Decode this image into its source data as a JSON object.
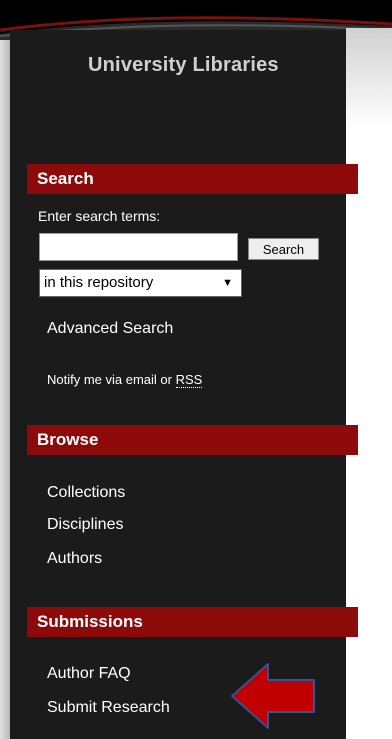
{
  "sidebar": {
    "title": "University Libraries"
  },
  "search": {
    "header": "Search",
    "prompt": "Enter search terms:",
    "input_value": "",
    "button_label": "Search",
    "scope_selected": "in this repository",
    "advanced_link": "Advanced Search",
    "notify_text": "Notify me via email or",
    "rss_label": "RSS"
  },
  "browse": {
    "header": "Browse",
    "items": [
      "Collections",
      "Disciplines",
      "Authors"
    ]
  },
  "submissions": {
    "header": "Submissions",
    "items": [
      "Author FAQ",
      "Submit Research"
    ]
  },
  "colors": {
    "sidebar_bg": "#1b1b1b",
    "header_red": "#8c0a0a",
    "arrow_red": "#c00000",
    "arrow_outline": "#2f5597"
  },
  "icons": {
    "dropdown": "triangle-down",
    "callout": "left-arrow"
  }
}
